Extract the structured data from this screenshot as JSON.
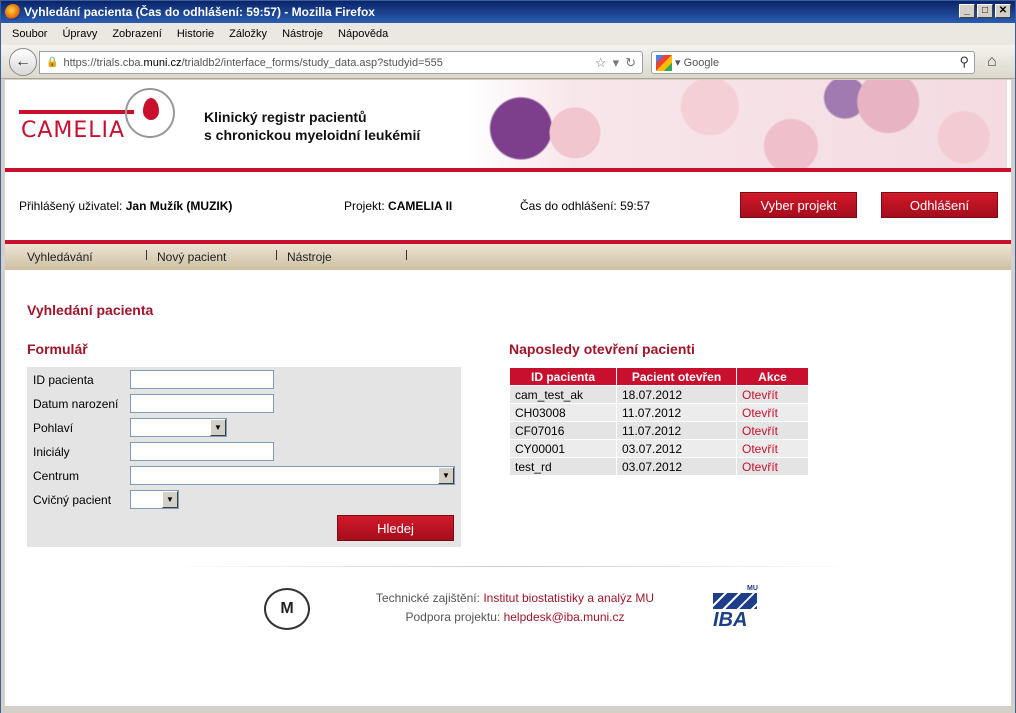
{
  "window": {
    "title": "Vyhledání pacienta (Čas do odhlášení: 59:57) - Mozilla Firefox",
    "buttons": [
      "_",
      "□",
      "✕"
    ]
  },
  "menubar": [
    "Soubor",
    "Úpravy",
    "Zobrazení",
    "Historie",
    "Záložky",
    "Nástroje",
    "Nápověda"
  ],
  "navbar": {
    "url_prefix": "https://trials.cba.",
    "url_domain": "muni.cz",
    "url_suffix": "/trialdb2/interface_forms/study_data.asp?studyid=555",
    "search_placeholder": "Google"
  },
  "header": {
    "logo": "CAMELIA",
    "title_line1": "Klinický registr pacientů",
    "title_line2": "s chronickou myeloidní leukémií"
  },
  "userbar": {
    "user_label": "Přihlášený uživatel:",
    "user_value": "Jan Mužík (MUZIK)",
    "project_label": "Projekt:",
    "project_value": "CAMELIA II",
    "timer_label": "Čas do odhlášení:",
    "timer_value": "59:57",
    "select_project_btn": "Vyber projekt",
    "logout_btn": "Odhlášení"
  },
  "mainnav": [
    "Vyhledávání",
    "Nový pacient",
    "Nástroje"
  ],
  "page_title": "Vyhledání pacienta",
  "form": {
    "title": "Formulář",
    "fields": [
      {
        "label": "ID pacienta",
        "value": ""
      },
      {
        "label": "Datum narození",
        "value": ""
      },
      {
        "label": "Pohlaví",
        "value": ""
      },
      {
        "label": "Iniciály",
        "value": ""
      },
      {
        "label": "Centrum",
        "value": ""
      },
      {
        "label": "Cvičný pacient",
        "value": ""
      }
    ],
    "search_btn": "Hledej"
  },
  "recent": {
    "title": "Naposledy otevření pacienti",
    "columns": [
      "ID pacienta",
      "Pacient otevřen",
      "Akce"
    ],
    "rows": [
      {
        "id": "cam_test_ak",
        "opened": "18.07.2012",
        "action": "Otevřít"
      },
      {
        "id": "CH03008",
        "opened": "11.07.2012",
        "action": "Otevřít"
      },
      {
        "id": "CF07016",
        "opened": "11.07.2012",
        "action": "Otevřít"
      },
      {
        "id": "CY00001",
        "opened": "03.07.2012",
        "action": "Otevřít"
      },
      {
        "id": "test_rd",
        "opened": "03.07.2012",
        "action": "Otevřít"
      }
    ]
  },
  "footer": {
    "tech_label": "Technické zajištění:",
    "tech_value": "Institut biostatistiky a analýz MU",
    "support_label": "Podpora projektu:",
    "support_value": "helpdesk@iba.muni.cz",
    "seal_letter": "M",
    "iba_logo": "IBA",
    "iba_mu": "MU"
  }
}
